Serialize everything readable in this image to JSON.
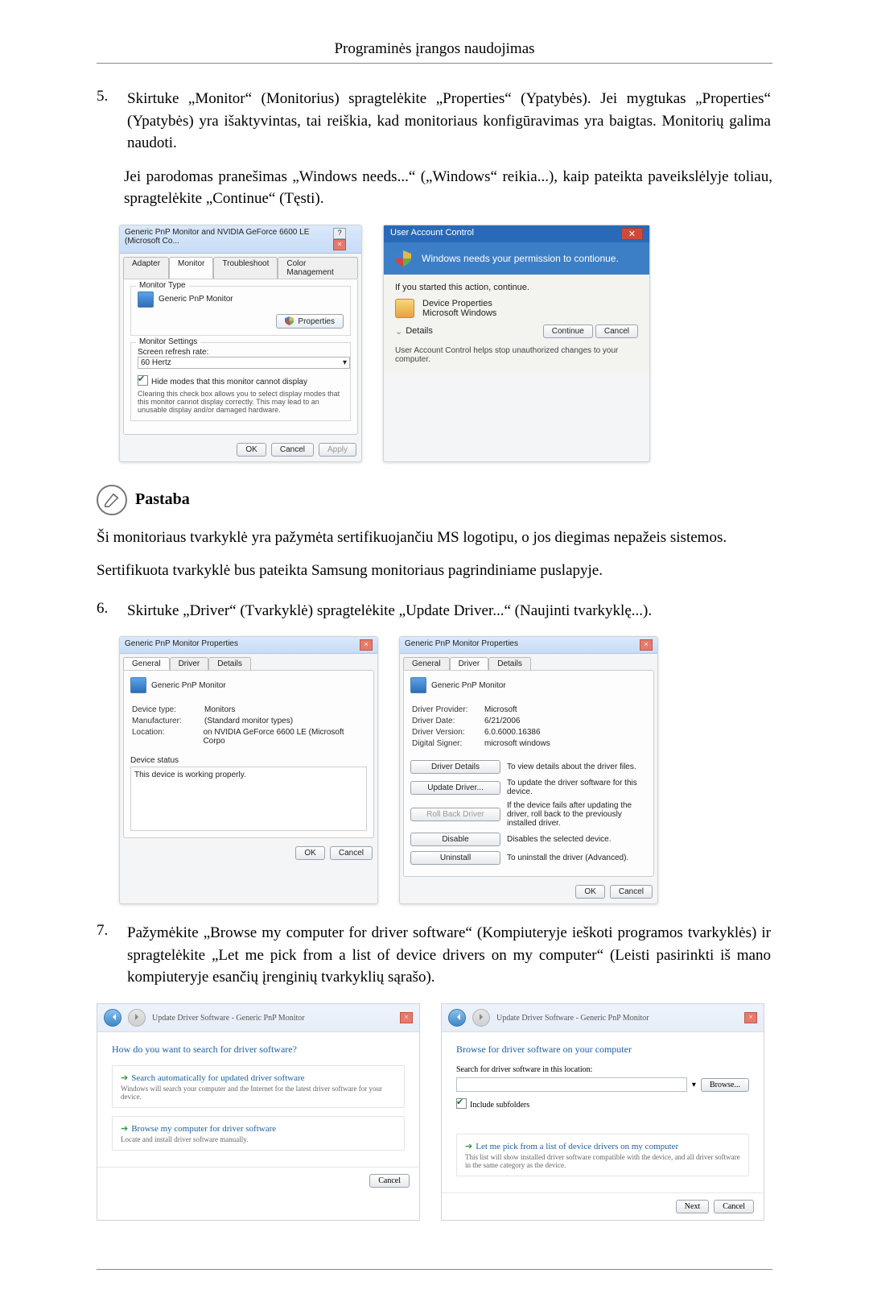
{
  "header": {
    "title": "Programinės įrangos naudojimas"
  },
  "items": {
    "5": {
      "num": "5.",
      "text": "Skirtuke „Monitor“ (Monitorius) spragtelėkite „Properties“ (Ypatybės). Jei mygtukas „Properties“ (Ypatybės) yra išaktyvintas, tai reiškia, kad monitoriaus konfigūravimas yra baigtas. Monitorių galima naudoti.",
      "text2": "Jei parodomas pranešimas „Windows needs...“ („Windows“ reikia...), kaip pateikta paveikslėlyje toliau, spragtelėkite „Continue“ (Tęsti)."
    },
    "6": {
      "num": "6.",
      "text": "Skirtuke „Driver“ (Tvarkyklė) spragtelėkite „Update Driver...“ (Naujinti tvarkyklę...)."
    },
    "7": {
      "num": "7.",
      "text": "Pažymėkite „Browse my computer for driver software“ (Kompiuteryje ieškoti programos tvarkyklės) ir spragtelėkite „Let me pick from a list of device drivers on my computer“ (Leisti pasirinkti iš mano kompiuteryje esančių įrenginių tvarkyklių sąrašo)."
    }
  },
  "note": {
    "label": "Pastaba",
    "p1": "Ši monitoriaus tvarkyklė yra pažymėta sertifikuojančiu MS logotipu, o jos diegimas nepažeis sistemos.",
    "p2": "Sertifikuota tvarkyklė bus pateikta Samsung monitoriaus pagrindiniame puslapyje."
  },
  "dlg_monitor": {
    "title": "Generic PnP Monitor and NVIDIA GeForce 6600 LE (Microsoft Co...",
    "tabs": {
      "adapter": "Adapter",
      "monitor": "Monitor",
      "troubleshoot": "Troubleshoot",
      "color": "Color Management"
    },
    "grp_type": "Monitor Type",
    "monitor_name": "Generic PnP Monitor",
    "properties": "Properties",
    "grp_settings": "Monitor Settings",
    "refresh_label": "Screen refresh rate:",
    "refresh_value": "60 Hertz",
    "hide_modes": "Hide modes that this monitor cannot display",
    "hide_note": "Clearing this check box allows you to select display modes that this monitor cannot display correctly. This may lead to an unusable display and/or damaged hardware.",
    "ok": "OK",
    "cancel": "Cancel",
    "apply": "Apply"
  },
  "dlg_uac": {
    "title": "User Account Control",
    "band": "Windows needs your permission to contionue.",
    "started": "If you started this action, continue.",
    "item_name": "Device Properties",
    "item_pub": "Microsoft Windows",
    "details": "Details",
    "continue": "Continue",
    "cancel": "Cancel",
    "foot": "User Account Control helps stop unauthorized changes to your computer."
  },
  "dlg_gen": {
    "title": "Generic PnP Monitor Properties",
    "tabs": {
      "general": "General",
      "driver": "Driver",
      "details": "Details"
    },
    "name": "Generic PnP Monitor",
    "kv": {
      "devtype_k": "Device type:",
      "devtype_v": "Monitors",
      "manu_k": "Manufacturer:",
      "manu_v": "(Standard monitor types)",
      "loc_k": "Location:",
      "loc_v": "on NVIDIA GeForce 6600 LE (Microsoft Corpo",
      "status_k": "Device status"
    },
    "status_text": "This device is working properly.",
    "ok": "OK",
    "cancel": "Cancel"
  },
  "dlg_drv": {
    "title": "Generic PnP Monitor Properties",
    "name": "Generic PnP Monitor",
    "kv": {
      "prov_k": "Driver Provider:",
      "prov_v": "Microsoft",
      "date_k": "Driver Date:",
      "date_v": "6/21/2006",
      "ver_k": "Driver Version:",
      "ver_v": "6.0.6000.16386",
      "sign_k": "Digital Signer:",
      "sign_v": "microsoft windows"
    },
    "btns": {
      "details": "Driver Details",
      "details_d": "To view details about the driver files.",
      "update": "Update Driver...",
      "update_d": "To update the driver software for this device.",
      "roll": "Roll Back Driver",
      "roll_d": "If the device fails after updating the driver, roll back to the previously installed driver.",
      "disable": "Disable",
      "disable_d": "Disables the selected device.",
      "uninstall": "Uninstall",
      "uninstall_d": "To uninstall the driver (Advanced)."
    },
    "ok": "OK",
    "cancel": "Cancel"
  },
  "wiz1": {
    "crumb": "Update Driver Software - Generic PnP Monitor",
    "h": "How do you want to search for driver software?",
    "opt1_t": "Search automatically for updated driver software",
    "opt1_d": "Windows will search your computer and the Internet for the latest driver software for your device.",
    "opt2_t": "Browse my computer for driver software",
    "opt2_d": "Locate and install driver software manually.",
    "cancel": "Cancel"
  },
  "wiz2": {
    "crumb": "Update Driver Software - Generic PnP Monitor",
    "h": "Browse for driver software on your computer",
    "path_label": "Search for driver software in this location:",
    "browse": "Browse...",
    "include": "Include subfolders",
    "opt_t": "Let me pick from a list of device drivers on my computer",
    "opt_d": "This list will show installed driver software compatible with the device, and all driver software in the same category as the device.",
    "next": "Next",
    "cancel": "Cancel"
  }
}
